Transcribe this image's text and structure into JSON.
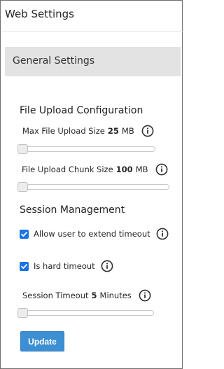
{
  "header": {
    "title": "Web Settings"
  },
  "section": {
    "title": "General Settings"
  },
  "file_upload": {
    "title": "File Upload Configuration",
    "max_size": {
      "label": "Max File Upload Size",
      "value": "25",
      "unit": "MB",
      "slider_fraction": 0.0
    },
    "chunk_size": {
      "label": "File Upload Chunk Size",
      "value": "100",
      "unit": "MB",
      "slider_fraction": 0.0
    }
  },
  "session": {
    "title": "Session Management",
    "extend_timeout": {
      "label": "Allow user to extend timeout",
      "checked": true
    },
    "hard_timeout": {
      "label": "Is hard timeout",
      "checked": true
    },
    "timeout": {
      "label": "Session Timeout",
      "value": "5",
      "unit": "Minutes",
      "slider_fraction": 0.0
    }
  },
  "actions": {
    "update_label": "Update"
  },
  "icons": {
    "info": "info-circle-icon",
    "check": "check-icon"
  },
  "colors": {
    "accent": "#3c8fd2",
    "checkbox": "#1a73e8",
    "section_bg": "#e3e3e3"
  }
}
